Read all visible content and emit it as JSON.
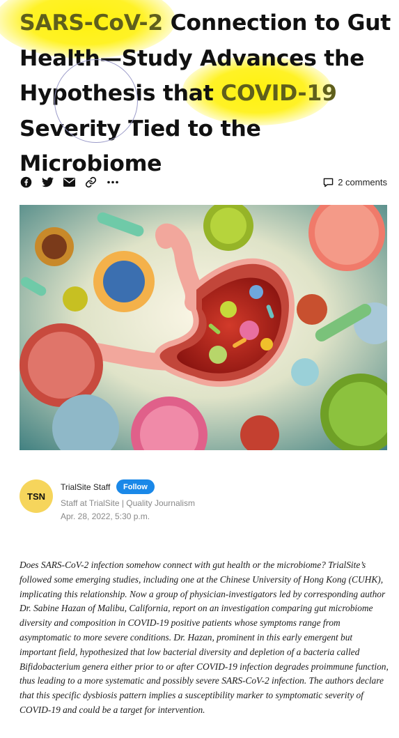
{
  "article": {
    "title_parts": [
      "SARS-CoV-2",
      " Connection to Gut Health—Study Advances the Hypothesis that ",
      "COVID-19",
      " Severity Tied to the Microbiome"
    ],
    "comments_label": "2 comments",
    "hero_image": "Illustration of a stomach and intestine surrounded by colorful virus and bacteria particles",
    "body": "Does SARS-CoV-2 infection somehow connect with gut health or the microbiome? TrialSite’s followed some emerging studies, including one at the Chinese University of Hong Kong (CUHK), implicating this relationship. Now a group of physician-investigators led by corresponding author Dr. Sabine Hazan of Malibu, California, report on an investigation comparing gut microbiome diversity and composition in COVID-19 positive patients whose symptoms range from asymptomatic to more severe conditions. Dr. Hazan, prominent in this early emergent but important field, hypothesized that low bacterial diversity and depletion of a bacteria called Bifidobacterium genera either prior to or after COVID-19 infection degrades proimmune function, thus leading to a more systematic and possibly severe SARS-CoV-2 infection. The authors declare that this specific dysbiosis pattern implies a susceptibility marker to symptomatic severity of COVID-19 and could be a target for intervention."
  },
  "share_icons": [
    "facebook-icon",
    "twitter-icon",
    "email-icon",
    "link-icon",
    "more-icon"
  ],
  "author": {
    "initials": "TSN",
    "name": "TrialSite Staff",
    "follow_label": "Follow",
    "bio": "Staff at TrialSite | Quality Journalism",
    "date": "Apr. 28, 2022, 5:30 p.m."
  },
  "colors": {
    "highlight": "#fff000",
    "follow": "#1a88e8",
    "avatar": "#f6d55c"
  }
}
